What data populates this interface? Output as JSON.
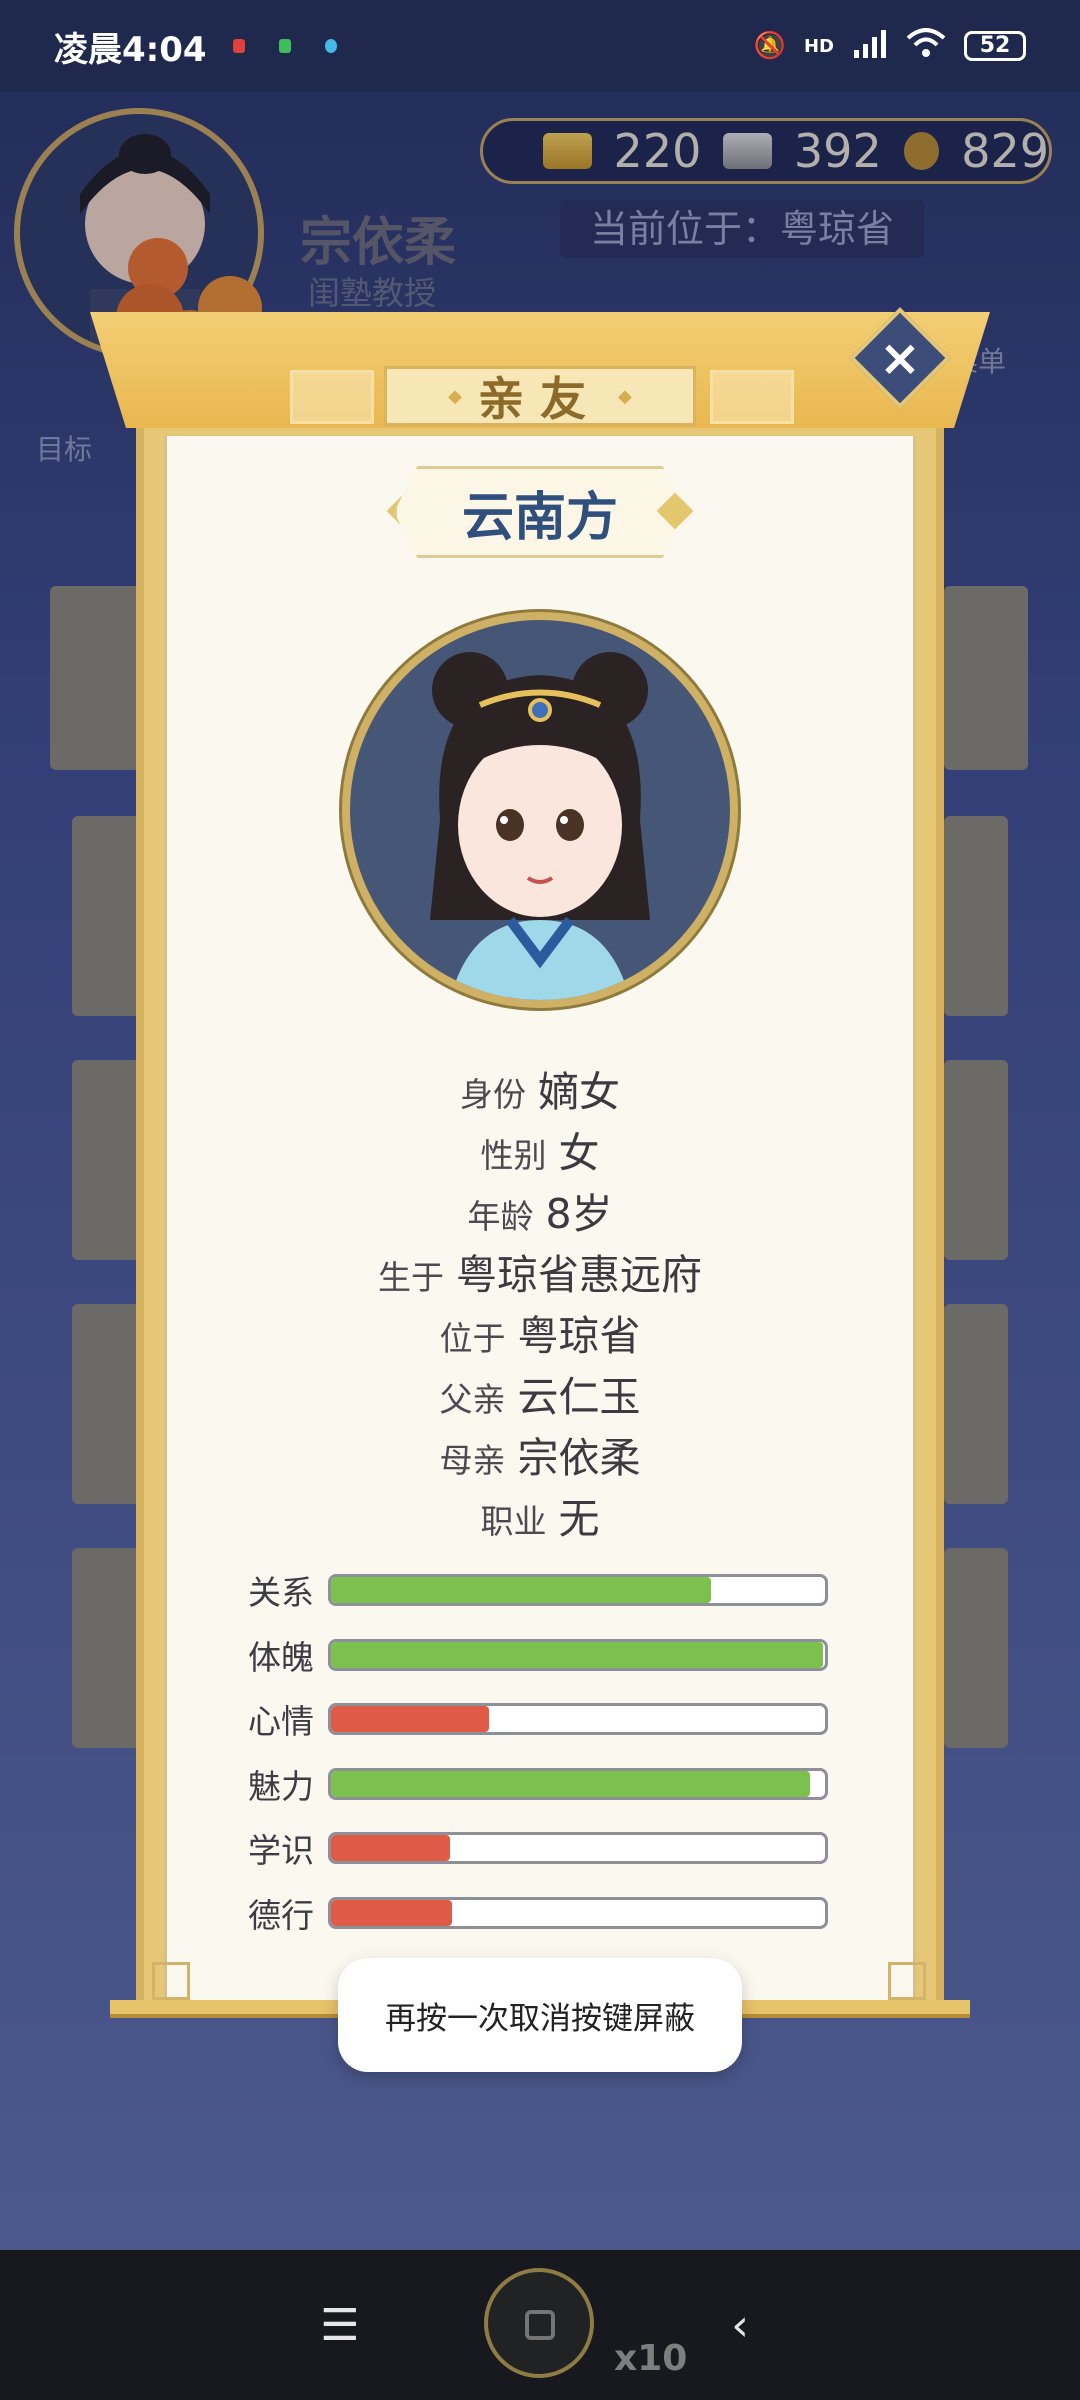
{
  "status_bar": {
    "time": "凌晨4:04",
    "network": "HD",
    "battery": "52"
  },
  "header": {
    "player_name": "宗依柔",
    "player_title": "闺塾教授",
    "location": "当前位于：粤琼省",
    "goal_label": "目标",
    "menu_label": "菜单"
  },
  "currency": {
    "gold": "220",
    "silver": "392",
    "coin": "829"
  },
  "dialog": {
    "title": "亲友",
    "person_name": "云南方",
    "info": [
      {
        "key": "身份",
        "value": "嫡女"
      },
      {
        "key": "性别",
        "value": "女"
      },
      {
        "key": "年龄",
        "value": "8岁"
      },
      {
        "key": "生于",
        "value": "粤琼省惠远府"
      },
      {
        "key": "位于",
        "value": "粤琼省"
      },
      {
        "key": "父亲",
        "value": "云仁玉"
      },
      {
        "key": "母亲",
        "value": "宗依柔"
      },
      {
        "key": "职业",
        "value": "无"
      }
    ],
    "stats": [
      {
        "label": "关系",
        "fraction": 0.77,
        "color": "#7cc04e"
      },
      {
        "label": "体魄",
        "fraction": 0.995,
        "color": "#7cc04e"
      },
      {
        "label": "心情",
        "fraction": 0.32,
        "color": "#e05a45"
      },
      {
        "label": "魅力",
        "fraction": 0.97,
        "color": "#7cc04e"
      },
      {
        "label": "学识",
        "fraction": 0.24,
        "color": "#e05a45"
      },
      {
        "label": "德行",
        "fraction": 0.245,
        "color": "#e05a45"
      }
    ]
  },
  "toast": "再按一次取消按键屏蔽",
  "nav": {
    "x10": "x10"
  }
}
